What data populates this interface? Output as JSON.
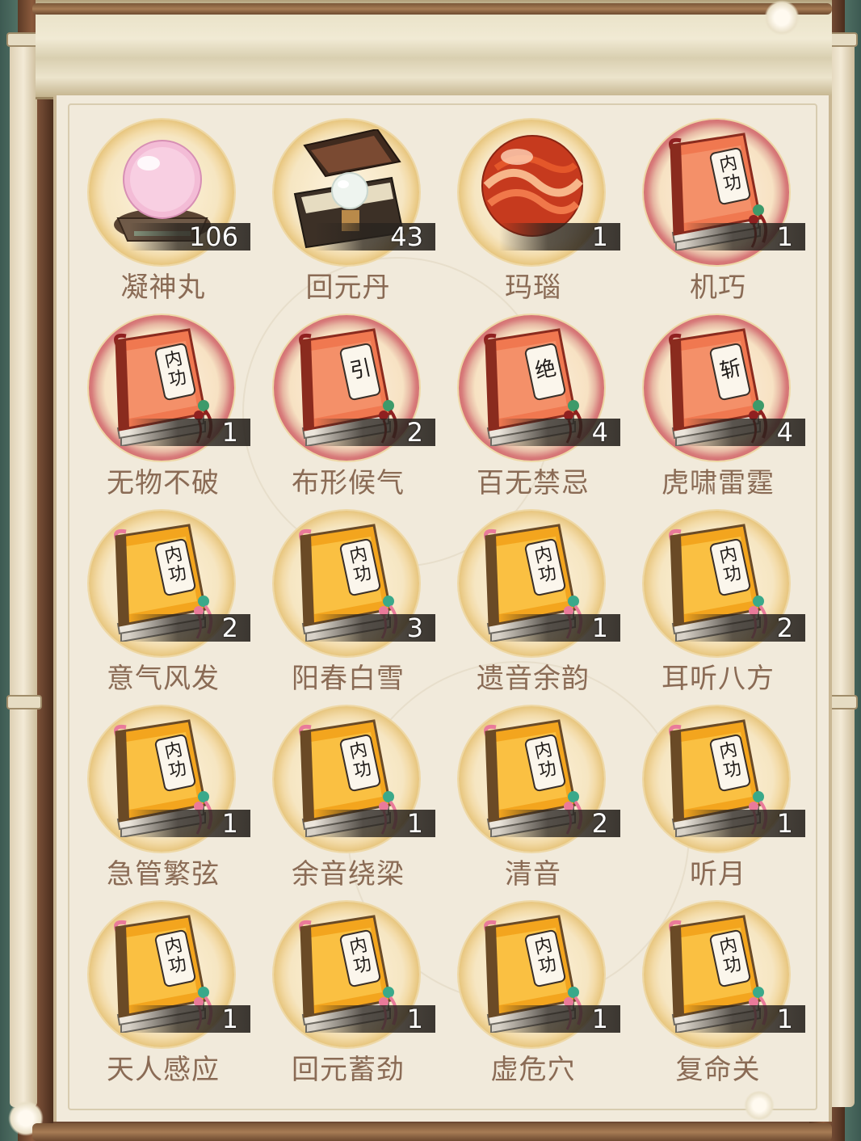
{
  "items": [
    {
      "name": "凝神丸",
      "count": "106",
      "icon": "pink-crystal-orb-icon",
      "ring": "gold"
    },
    {
      "name": "回元丹",
      "count": "43",
      "icon": "treasure-chest-pearl-icon",
      "ring": "gold"
    },
    {
      "name": "玛瑙",
      "count": "1",
      "icon": "agate-orb-icon",
      "ring": "gold"
    },
    {
      "name": "机巧",
      "count": "1",
      "icon": "red-manual-book-icon",
      "ring": "red"
    },
    {
      "name": "无物不破",
      "count": "1",
      "icon": "red-manual-book-icon",
      "ring": "red"
    },
    {
      "name": "布形候气",
      "count": "2",
      "icon": "red-manual-book-icon",
      "ring": "red"
    },
    {
      "name": "百无禁忌",
      "count": "4",
      "icon": "red-manual-book-icon",
      "ring": "red"
    },
    {
      "name": "虎啸雷霆",
      "count": "4",
      "icon": "red-manual-book-icon",
      "ring": "red"
    },
    {
      "name": "意气风发",
      "count": "2",
      "icon": "gold-manual-book-icon",
      "ring": "gold"
    },
    {
      "name": "阳春白雪",
      "count": "3",
      "icon": "gold-manual-book-icon",
      "ring": "gold"
    },
    {
      "name": "遗音余韵",
      "count": "1",
      "icon": "gold-manual-book-icon",
      "ring": "gold"
    },
    {
      "name": "耳听八方",
      "count": "2",
      "icon": "gold-manual-book-icon",
      "ring": "gold"
    },
    {
      "name": "急管繁弦",
      "count": "1",
      "icon": "gold-manual-book-icon",
      "ring": "gold"
    },
    {
      "name": "余音绕梁",
      "count": "1",
      "icon": "gold-manual-book-icon",
      "ring": "gold"
    },
    {
      "name": "清音",
      "count": "2",
      "icon": "gold-manual-book-icon",
      "ring": "gold"
    },
    {
      "name": "听月",
      "count": "1",
      "icon": "gold-manual-book-icon",
      "ring": "gold"
    },
    {
      "name": "天人感应",
      "count": "1",
      "icon": "gold-manual-book-icon",
      "ring": "gold"
    },
    {
      "name": "回元蓄劲",
      "count": "1",
      "icon": "gold-manual-book-icon",
      "ring": "gold"
    },
    {
      "name": "虚危穴",
      "count": "1",
      "icon": "gold-manual-book-icon",
      "ring": "gold"
    },
    {
      "name": "复命关",
      "count": "1",
      "icon": "gold-manual-book-icon",
      "ring": "gold"
    }
  ],
  "book_seal_text": {
    "red_3": "内功",
    "red_4": "内功",
    "red_5": "引",
    "red_6": "绝",
    "red_7": "斩",
    "gold": "内功"
  },
  "colors": {
    "label_text": "#8a6b55",
    "count_text": "#ffffff",
    "panel_bg": "#f1eadb",
    "gold_ring": "#e8c781",
    "red_ring": "#d46f6f"
  }
}
